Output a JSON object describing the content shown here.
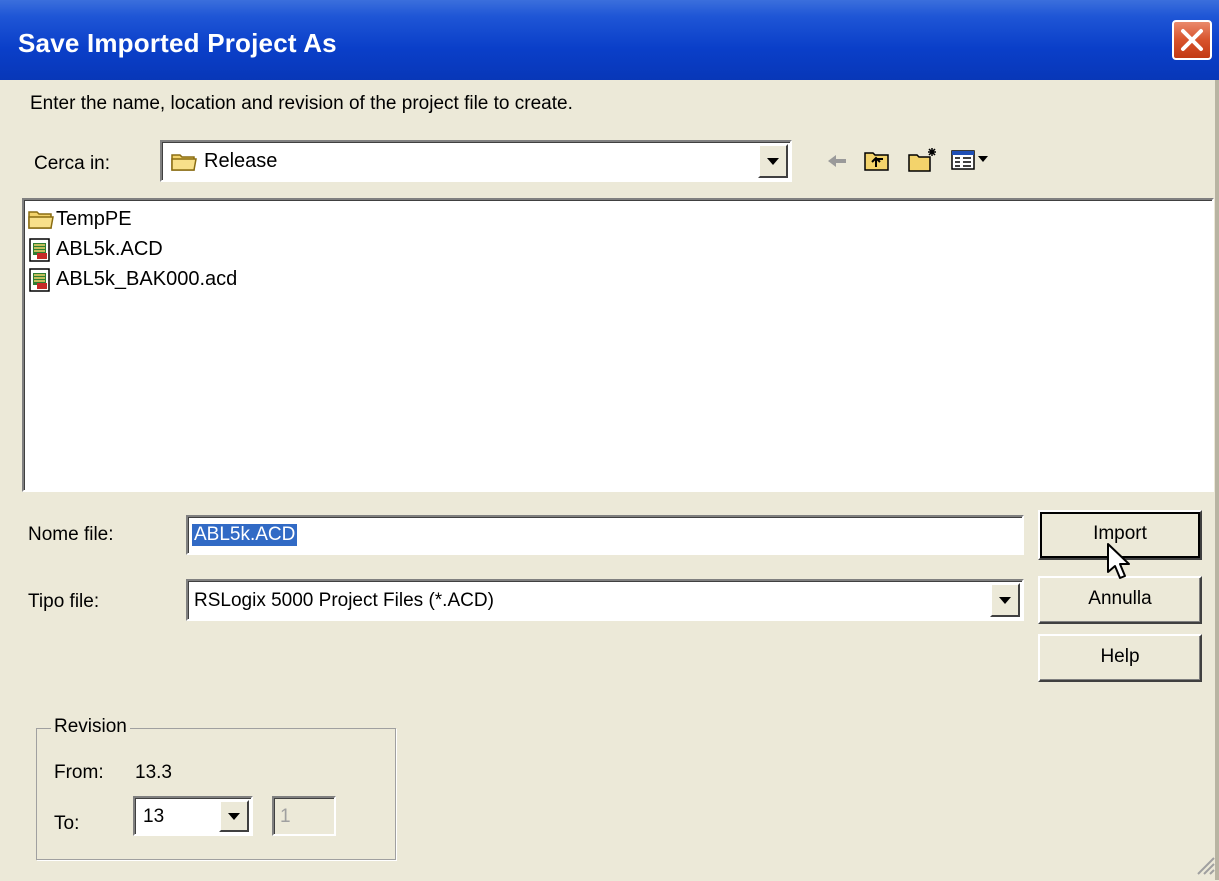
{
  "dialog": {
    "title": "Save Imported Project As",
    "instruction": "Enter the name, location and revision of the project file to create."
  },
  "look_in": {
    "label": "Cerca in:",
    "value": "Release",
    "toolbar_icons": [
      "back-arrow-icon",
      "up-folder-icon",
      "new-folder-icon",
      "view-menu-icon"
    ]
  },
  "files": [
    {
      "name": "TempPE",
      "icon": "folder-icon"
    },
    {
      "name": "ABL5k.ACD",
      "icon": "acd-file-icon"
    },
    {
      "name": "ABL5k_BAK000.acd",
      "icon": "acd-file-icon"
    }
  ],
  "filename": {
    "label": "Nome file:",
    "value": "ABL5k.ACD"
  },
  "filetype": {
    "label": "Tipo file:",
    "value": "RSLogix 5000 Project Files (*.ACD)"
  },
  "buttons": {
    "import": "Import",
    "cancel": "Annulla",
    "help": "Help"
  },
  "revision": {
    "group_label": "Revision",
    "from_label": "From:",
    "from_value": "13.3",
    "to_label": "To:",
    "to_major": "13",
    "to_minor": "1"
  },
  "colors": {
    "titlebar": "#0a3fc9",
    "dialog_bg": "#ece9d8",
    "selection": "#316ac5",
    "close_button": "#d8532c"
  }
}
